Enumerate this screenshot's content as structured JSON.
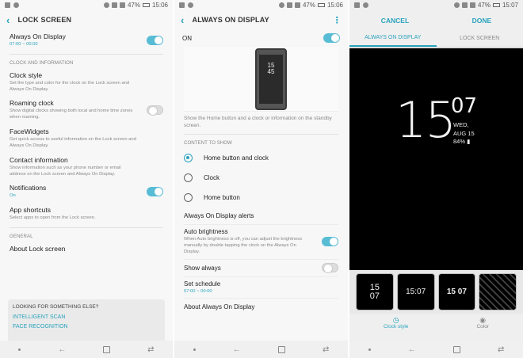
{
  "status": [
    {
      "battery": "47%",
      "time": "15:06"
    },
    {
      "battery": "47%",
      "time": "15:06"
    },
    {
      "battery": "47%",
      "time": "15:07"
    }
  ],
  "lock": {
    "title": "LOCK SCREEN",
    "items": [
      {
        "title": "Always On Display",
        "sub": "07:00 ~ 00:00",
        "toggle": "on"
      },
      {
        "section": "CLOCK AND INFORMATION"
      },
      {
        "title": "Clock style",
        "sub": "Set the type and color for the clock on the Lock screen and Always On Display."
      },
      {
        "title": "Roaming clock",
        "sub": "Show digital clocks showing both local and home time zones when roaming.",
        "toggle": "off"
      },
      {
        "title": "FaceWidgets",
        "sub": "Get quick access to useful information on the Lock screen and Always On Display."
      },
      {
        "title": "Contact information",
        "sub": "Show information such as your phone number or email address on the Lock screen and Always On Display."
      },
      {
        "title": "Notifications",
        "sub": "On",
        "toggle": "on"
      },
      {
        "title": "App shortcuts",
        "sub": "Select apps to open from the Lock screen."
      },
      {
        "section": "GENERAL"
      },
      {
        "title": "About Lock screen"
      }
    ],
    "look": {
      "heading": "LOOKING FOR SOMETHING ELSE?",
      "links": [
        "INTELLIGENT SCAN",
        "FACE RECOGNITION"
      ]
    }
  },
  "aod": {
    "title": "ALWAYS ON DISPLAY",
    "on_label": "ON",
    "preview_hour": "15",
    "preview_min": "45",
    "description": "Show the Home button and a clock or information on the standby screen.",
    "content_heading": "CONTENT TO SHOW",
    "options": [
      "Home button and clock",
      "Clock",
      "Home button"
    ],
    "alerts": "Always On Display alerts",
    "auto_brightness_title": "Auto brightness",
    "auto_brightness_sub": "When Auto brightness is off, you can adjust the brightness manually by double tapping the clock on the Always On Display.",
    "show_always": "Show always",
    "schedule_title": "Set schedule",
    "schedule_sub": "07:00 ~ 00:00",
    "about": "About Always On Display"
  },
  "clockstyle": {
    "cancel": "CANCEL",
    "done": "DONE",
    "tabs": [
      "ALWAYS ON DISPLAY",
      "LOCK SCREEN"
    ],
    "hour": "15",
    "minute": "07",
    "day": "WED,",
    "date": "AUG 15",
    "battery": "84%",
    "thumb_times": [
      "15\n07",
      "15:07",
      "15 07",
      ""
    ],
    "options": [
      "Clock style",
      "Color"
    ]
  }
}
